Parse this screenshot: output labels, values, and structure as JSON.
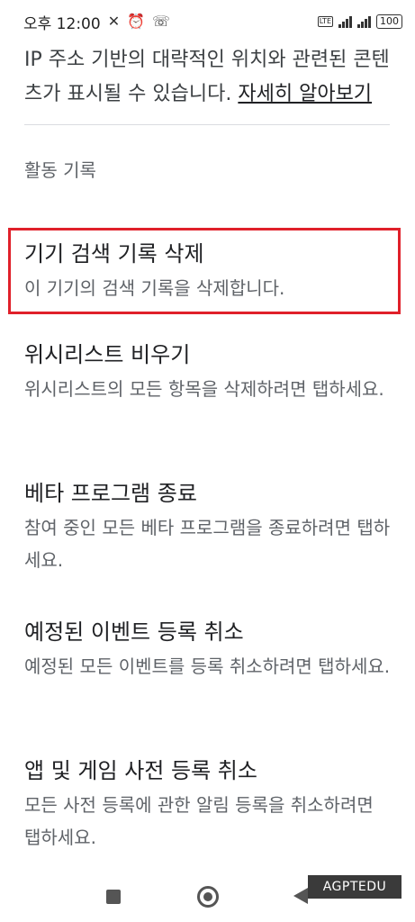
{
  "status_bar": {
    "time": "오후 12:00",
    "battery": "100",
    "lte_label": "LTE"
  },
  "intro": {
    "text": "IP 주소 기반의 대략적인 위치와 관련된 콘텐츠가 표시될 수 있습니다. ",
    "link": "자세히 알아보기"
  },
  "section_label": "활동 기록",
  "items": [
    {
      "title": "기기 검색 기록 삭제",
      "desc": "이 기기의 검색 기록을 삭제합니다."
    },
    {
      "title": "위시리스트 비우기",
      "desc": "위시리스트의 모든 항목을 삭제하려면 탭하세요."
    },
    {
      "title": "베타 프로그램 종료",
      "desc": "참여 중인 모든 베타 프로그램을 종료하려면 탭하세요."
    },
    {
      "title": "예정된 이벤트 등록 취소",
      "desc": "예정된 모든 이벤트를 등록 취소하려면 탭하세요."
    },
    {
      "title": "앱 및 게임 사전 등록 취소",
      "desc": "모든 사전 등록에 관한 알림 등록을 취소하려면 탭하세요."
    }
  ],
  "highlight_color": "#e0202a",
  "watermark": "AGPTEDU",
  "icons": {
    "mute": "mute-icon",
    "alarm": "alarm-icon",
    "wifi_call": "wifi-call-icon",
    "recents": "recents-icon",
    "home": "home-icon",
    "back": "back-icon"
  }
}
